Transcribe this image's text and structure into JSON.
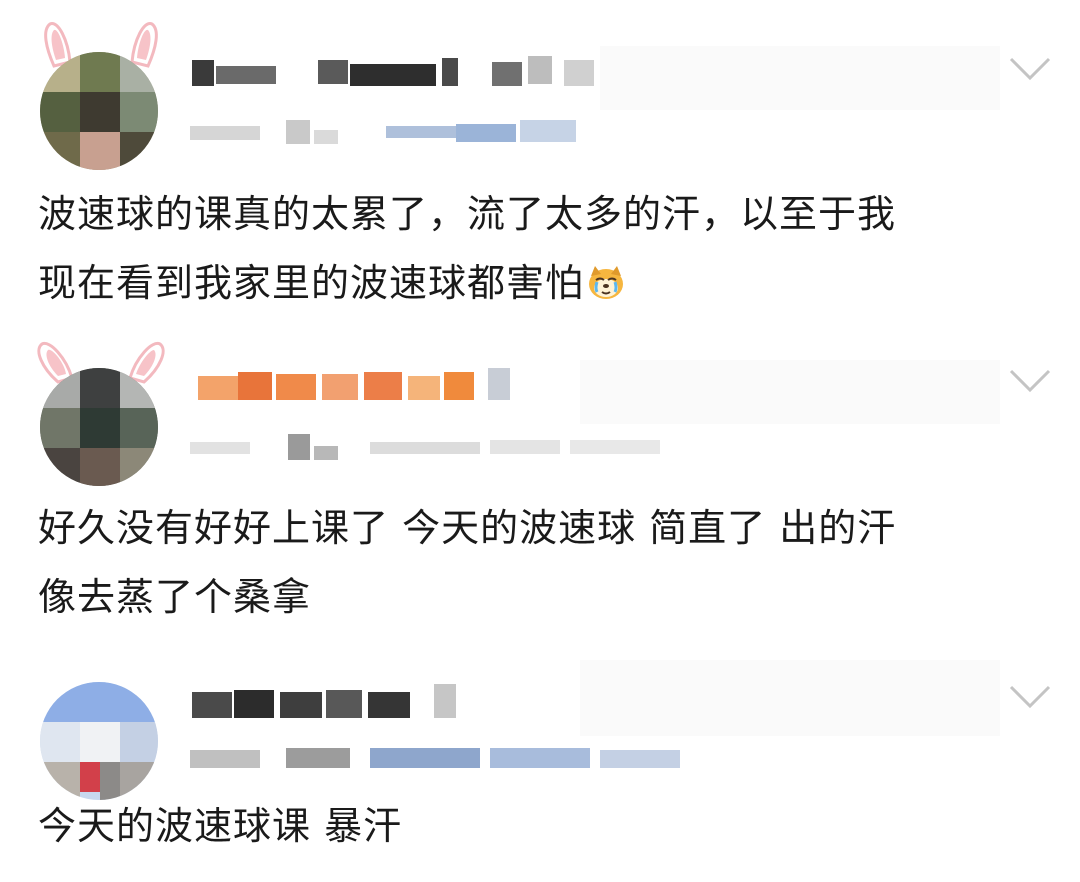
{
  "posts": [
    {
      "content_lines": [
        "波速球的课真的太累了，流了太多的汗，以至于我",
        "现在看到我家里的波速球都害怕"
      ],
      "emoji": "crying-dog-emoji"
    },
    {
      "content_lines": [
        "好久没有好好上课了 今天的波速球 简直了 出的汗",
        "像去蒸了个桑拿"
      ],
      "emoji": null
    },
    {
      "content_lines": [
        "今天的波速球课 暴汗"
      ],
      "emoji": null
    }
  ],
  "icons": {
    "chevron": "chevron-down-icon",
    "ears": "bunny-ears-decoration"
  },
  "colors": {
    "text": "#1a1a1a",
    "chevron": "#c4c4c4",
    "name_orange": "#f08a3c",
    "meta_blue": "#9bb4d8",
    "meta_gray": "#c8c8c8"
  }
}
